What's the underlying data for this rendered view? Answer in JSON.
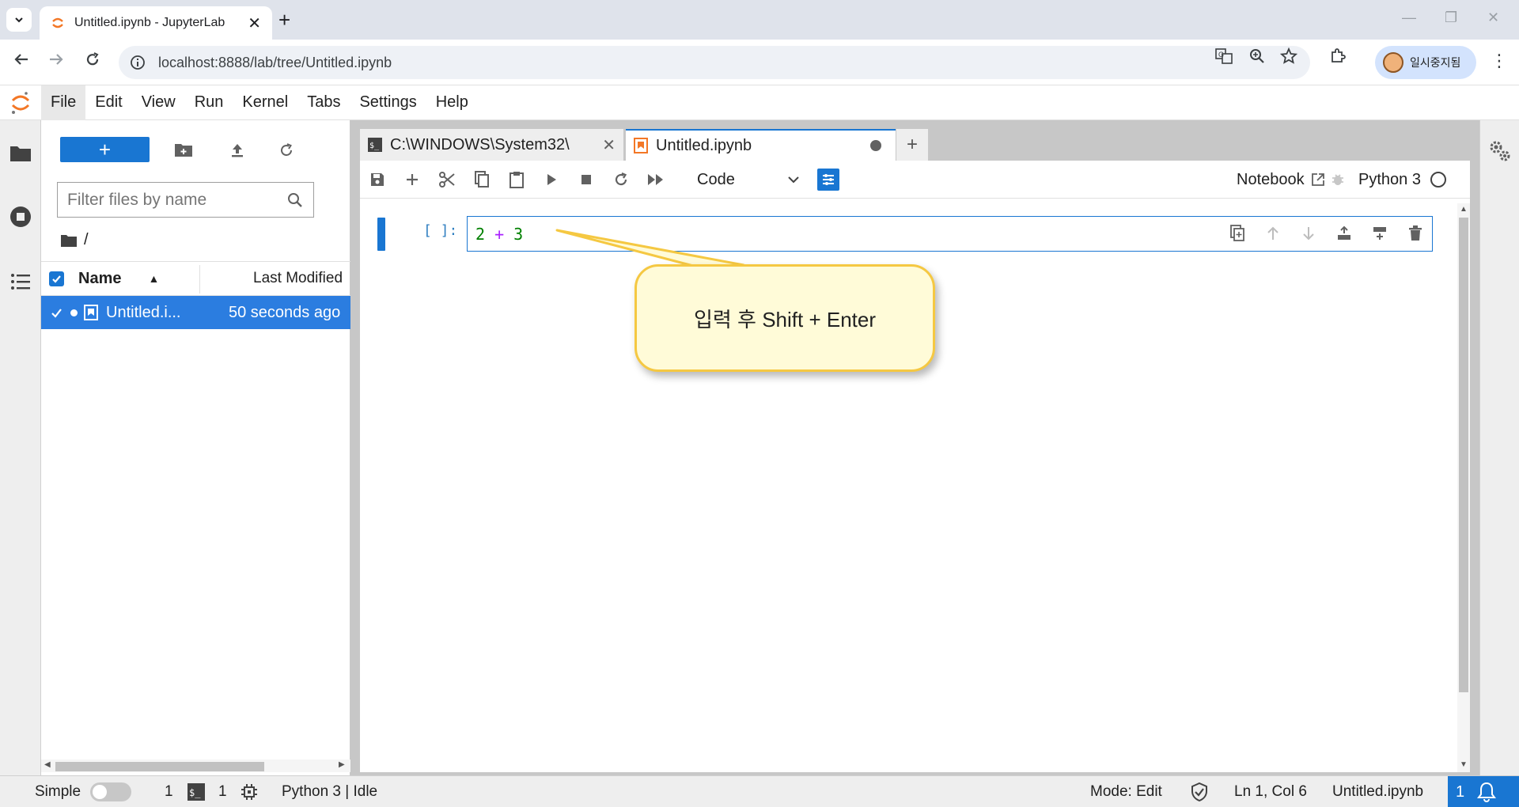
{
  "browser": {
    "tab_title": "Untitled.ipynb - JupyterLab",
    "url": "localhost:8888/lab/tree/Untitled.ipynb",
    "profile_name": "일시중지됨"
  },
  "menubar": {
    "items": [
      "File",
      "Edit",
      "View",
      "Run",
      "Kernel",
      "Tabs",
      "Settings",
      "Help"
    ]
  },
  "filebrowser": {
    "new_label": "+",
    "filter_placeholder": "Filter files by name",
    "breadcrumb": "/",
    "col_name": "Name",
    "col_modified": "Last Modified",
    "files": [
      {
        "name": "Untitled.ipynb",
        "name_display": "Untitled.i...",
        "modified": "50 seconds ago",
        "selected": true,
        "running": true
      }
    ]
  },
  "doc_tabs": [
    {
      "label": "C:\\WINDOWS\\System32\\",
      "icon": "terminal-icon",
      "active": false
    },
    {
      "label": "Untitled.ipynb",
      "icon": "notebook-icon",
      "active": true,
      "unsaved": true
    }
  ],
  "notebook": {
    "cell_type": "Code",
    "notebook_label": "Notebook",
    "kernel_name": "Python 3",
    "cell": {
      "prompt": "[ ]:",
      "tokens": [
        {
          "text": "2",
          "kind": "num"
        },
        {
          "text": " + ",
          "kind": "op"
        },
        {
          "text": "3",
          "kind": "num"
        }
      ]
    }
  },
  "callout": {
    "text": "입력 후 Shift + Enter"
  },
  "statusbar": {
    "mode_label": "Simple",
    "terminals_count": "1",
    "kernels_count": "1",
    "kernel_status": "Python 3 | Idle",
    "edit_mode": "Mode: Edit",
    "cursor": "Ln 1, Col 6",
    "filename": "Untitled.ipynb",
    "notifications": "1"
  },
  "colors": {
    "accent": "#1976d2",
    "selection": "#2b7de0",
    "jupyter_orange": "#f37726",
    "callout_bg": "#fffbd8",
    "callout_border": "#f5c842"
  }
}
